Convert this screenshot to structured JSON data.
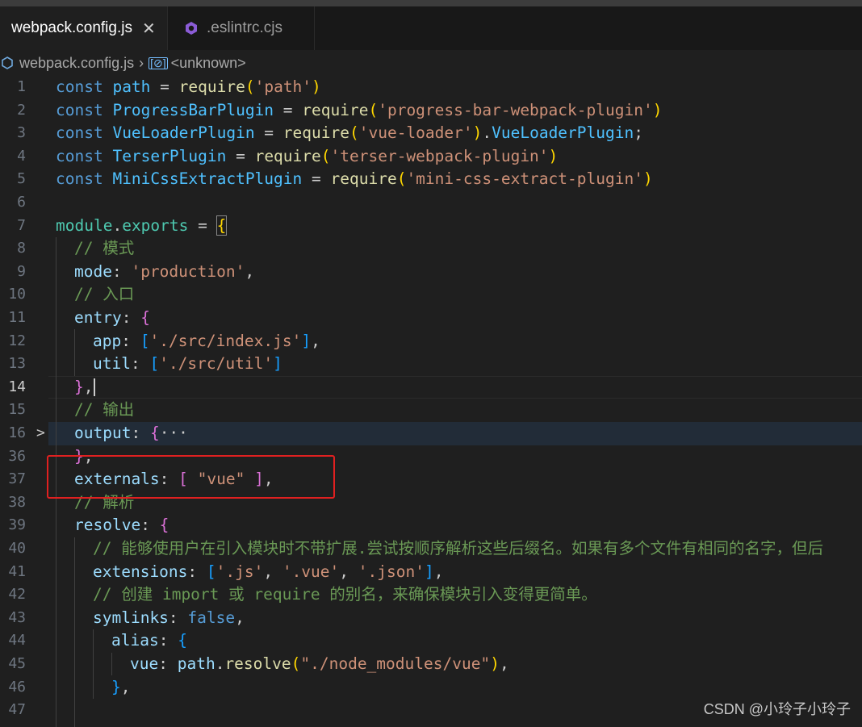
{
  "tabs": [
    {
      "label": "webpack.config.js",
      "close": "✕"
    },
    {
      "label": ".eslintrc.cjs"
    }
  ],
  "breadcrumb": {
    "file": "webpack.config.js",
    "separator": "›",
    "symbol_icon": "[⊘]",
    "symbol": "<unknown>"
  },
  "gutter": [
    "1",
    "2",
    "3",
    "4",
    "5",
    "6",
    "7",
    "8",
    "9",
    "10",
    "11",
    "12",
    "13",
    "14",
    "15",
    "16",
    "36",
    "37",
    "38",
    "39",
    "40",
    "41",
    "42",
    "43",
    "44",
    "45",
    "46",
    "47"
  ],
  "code": {
    "l1": {
      "k": "const",
      "v": "path",
      "eq": " = ",
      "f": "require",
      "o": "(",
      "s": "'path'",
      "c": ")"
    },
    "l2": {
      "k": "const",
      "v": "ProgressBarPlugin",
      "eq": " = ",
      "f": "require",
      "o": "(",
      "s": "'progress-bar-webpack-plugin'",
      "c": ")"
    },
    "l3": {
      "k": "const",
      "v": "VueLoaderPlugin",
      "eq": " = ",
      "f": "require",
      "o": "(",
      "s": "'vue-loader'",
      "c": ")",
      "d": ".",
      "t": "VueLoaderPlugin",
      "e": ";"
    },
    "l4": {
      "k": "const",
      "v": "TerserPlugin",
      "eq": " = ",
      "f": "require",
      "o": "(",
      "s": "'terser-webpack-plugin'",
      "c": ")"
    },
    "l5": {
      "k": "const",
      "v": "MiniCssExtractPlugin",
      "eq": " = ",
      "f": "require",
      "o": "(",
      "s": "'mini-css-extract-plugin'",
      "c": ")"
    },
    "l7": {
      "a": "module",
      "d": ".",
      "b": "exports",
      "eq": " = ",
      "o": "{"
    },
    "l8": "// 模式",
    "l9": {
      "p": "mode",
      "col": ": ",
      "s": "'production'",
      "e": ","
    },
    "l10": "// 入口",
    "l11": {
      "p": "entry",
      "col": ": ",
      "o": "{"
    },
    "l12": {
      "p": "app",
      "col": ": ",
      "o": "[",
      "s": "'./src/index.js'",
      "c": "]",
      "e": ","
    },
    "l13": {
      "p": "util",
      "col": ": ",
      "o": "[",
      "s": "'./src/util'",
      "c": "]"
    },
    "l14": {
      "c": "}",
      "e": ","
    },
    "l15": "// 输出",
    "l16": {
      "p": "output",
      "col": ": ",
      "o": "{",
      "more": "···"
    },
    "l36": {
      "c": "}",
      "e": ","
    },
    "l37": {
      "p": "externals",
      "col": ": ",
      "o": "[",
      "s": " \"vue\" ",
      "c": "]",
      "e": ","
    },
    "l38": "// 解析",
    "l39": {
      "p": "resolve",
      "col": ": ",
      "o": "{"
    },
    "l40": "// 能够使用户在引入模块时不带扩展.尝试按顺序解析这些后缀名。如果有多个文件有相同的名字，但后",
    "l41": {
      "p": "extensions",
      "col": ": ",
      "o": "[",
      "s1": "'.js'",
      "cm1": ", ",
      "s2": "'.vue'",
      "cm2": ", ",
      "s3": "'.json'",
      "c": "]",
      "e": ","
    },
    "l42": "// 创建 import 或 require 的别名，来确保模块引入变得更简单。",
    "l43": {
      "p": "symlinks",
      "col": ": ",
      "k": "false",
      "e": ","
    },
    "l44": {
      "p": "alias",
      "col": ": ",
      "o": "{"
    },
    "l45": {
      "p": "vue",
      "col": ": ",
      "a": "path",
      "d": ".",
      "f": "resolve",
      "o": "(",
      "s": "\"./node_modules/vue\"",
      "c": ")",
      "e": ","
    },
    "l46": {
      "c": "}",
      "e": ","
    }
  },
  "watermark": "CSDN @小玲子小玲子"
}
